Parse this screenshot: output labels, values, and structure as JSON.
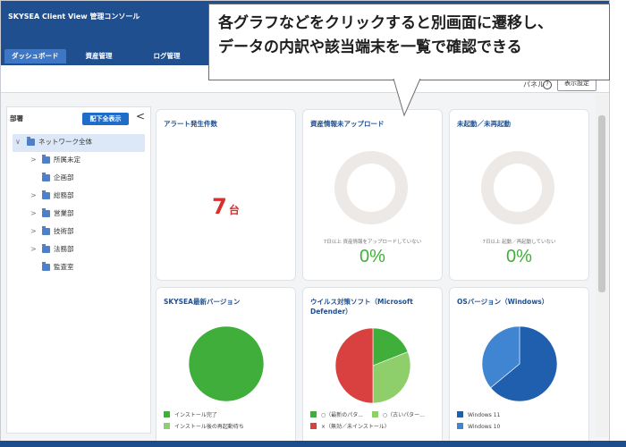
{
  "app": {
    "title": "SKYSEA Client View 管理コンソール"
  },
  "nav_tabs": [
    {
      "label": "ダッシュボード",
      "active": true
    },
    {
      "label": "資産管理",
      "active": false
    },
    {
      "label": "ログ管理",
      "active": false
    }
  ],
  "toolbar": {
    "panel_label": "パネル",
    "help_glyph": "?",
    "display_settings_label": "表示設定"
  },
  "sidebar": {
    "title": "部署",
    "show_all_label": "配下全表示",
    "collapse_glyph": "<",
    "tree": [
      {
        "label": "ネットワーク全体",
        "expanded": true,
        "level": 0
      },
      {
        "label": "所属未定",
        "has_children": true,
        "level": 1
      },
      {
        "label": "企画部",
        "has_children": false,
        "level": 1
      },
      {
        "label": "総務部",
        "has_children": true,
        "level": 1
      },
      {
        "label": "営業部",
        "has_children": true,
        "level": 1
      },
      {
        "label": "技術部",
        "has_children": true,
        "level": 1
      },
      {
        "label": "法務部",
        "has_children": true,
        "level": 1
      },
      {
        "label": "監査室",
        "has_children": false,
        "level": 1
      }
    ]
  },
  "cards": {
    "alerts": {
      "title": "アラート発生件数",
      "value": "7",
      "unit": "台"
    },
    "asset_upload": {
      "title": "資産情報未アップロード",
      "note": "7日以上 資産情報をアップロードしていない",
      "percent": "0%"
    },
    "not_started": {
      "title": "未起動／未再起動",
      "note": "7日以上 起動／再起動していない",
      "percent": "0%"
    },
    "skysea_version": {
      "title": "SKYSEA最新バージョン",
      "legend": [
        {
          "label": "インストール完了",
          "color": "#3fae3a"
        },
        {
          "label": "インストール後の再起動待ち",
          "color": "#8fcf6b"
        }
      ]
    },
    "antivirus": {
      "title": "ウイルス対策ソフト（Microsoft Defender）",
      "title_line1": "ウイルス対策ソフト（Microsoft",
      "title_line2": "Defender）",
      "legend": [
        {
          "label": "○（最新のパタ...",
          "color": "#3fae3a"
        },
        {
          "label": "○（古いパター...",
          "color": "#8fcf6b"
        },
        {
          "label": "×（無効／未インストール）",
          "color": "#d8413f"
        }
      ]
    },
    "os_version": {
      "title": "OSバージョン（Windows）",
      "legend": [
        {
          "label": "Windows 11",
          "color": "#1f5fae"
        },
        {
          "label": "Windows 10",
          "color": "#3f85d1"
        }
      ]
    }
  },
  "callout": {
    "line1": "各グラフなどをクリックすると別画面に遷移し、",
    "line2": "データの内訳や該当端末を一覧で確認できる"
  },
  "chart_data": [
    {
      "type": "pie",
      "title": "資産情報未アップロード",
      "categories": [
        "資産情報未アップロード"
      ],
      "values": [
        0
      ],
      "unit": "%"
    },
    {
      "type": "pie",
      "title": "未起動／未再起動",
      "categories": [
        "未起動／未再起動"
      ],
      "values": [
        0
      ],
      "unit": "%"
    },
    {
      "type": "pie",
      "title": "SKYSEA最新バージョン",
      "categories": [
        "インストール完了",
        "インストール後の再起動待ち"
      ],
      "values": [
        100,
        0
      ]
    },
    {
      "type": "pie",
      "title": "ウイルス対策ソフト（Microsoft Defender）",
      "categories": [
        "○（最新のパタ...",
        "○（古いパター...",
        "×（無効／未インストール）"
      ],
      "values": [
        19,
        31,
        50
      ]
    },
    {
      "type": "pie",
      "title": "OSバージョン（Windows）",
      "categories": [
        "Windows 11",
        "Windows 10"
      ],
      "values": [
        64,
        36
      ]
    }
  ]
}
